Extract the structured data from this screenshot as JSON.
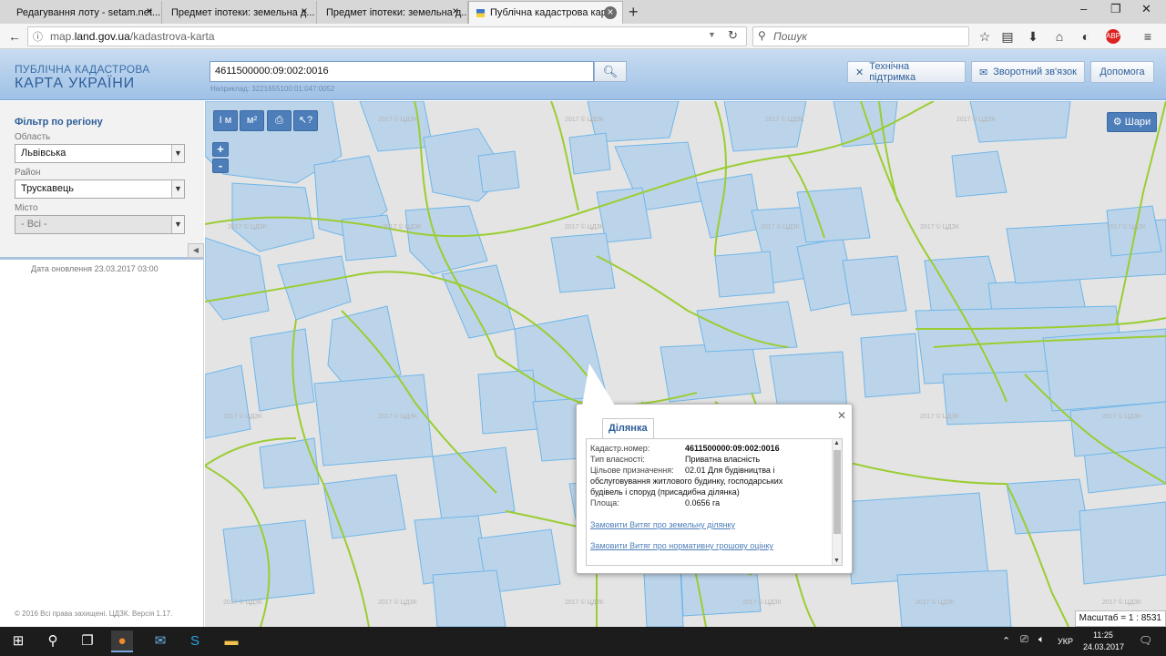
{
  "browser": {
    "tabs": [
      {
        "title": "Редагування лоту - setam.net..."
      },
      {
        "title": "Предмет іпотеки: земельна д..."
      },
      {
        "title": "Предмет іпотеки: земельна д..."
      },
      {
        "title": "Публічна кадастрова кар..."
      }
    ],
    "url_prefix": "map.",
    "url_domain": "land.gov.ua",
    "url_path": "/kadastrova-karta",
    "search_placeholder": "Пошук"
  },
  "header": {
    "logo_line1": "ПУБЛІЧНА КАДАСТРОВА",
    "logo_line2": "КАРТА УКРАЇНИ",
    "cad_input_value": "4611500000:09:002:0016",
    "example_text": "Наприклад: 3221655100:01:047:0052",
    "buttons": {
      "support": "Технічна підтримка",
      "feedback": "Зворотний зв'язок",
      "help": "Допомога"
    }
  },
  "filter": {
    "title": "Фільтр по регіону",
    "oblast_label": "Область",
    "oblast_value": "Львівська",
    "rayon_label": "Район",
    "rayon_value": "Трускавець",
    "misto_label": "Місто",
    "misto_value": "- Всі -",
    "update_label": "Дата оновлення",
    "update_value": "23.03.2017 03:00",
    "copyright": "© 2016 Всі права захищені. ЦДЗК. Версія 1.17."
  },
  "map": {
    "tools": {
      "measure_line": "I м",
      "measure_area": "м²",
      "print": "print",
      "identify": "?"
    },
    "zoom_in": "+",
    "zoom_out": "-",
    "layers_label": "Шари",
    "scale_text": "Масштаб = 1 : 8531",
    "watermark": "2017 © ЦДЗК"
  },
  "popup": {
    "tab_label": "Ділянка",
    "rows": [
      {
        "label": "Кадастр.номер:",
        "value": "4611500000:09:002:0016"
      },
      {
        "label": "Тип власності:",
        "value": "Приватна власність"
      },
      {
        "label": "Цільове призначення:",
        "value": "02.01 Для будівництва і"
      },
      {
        "label": "Площа:",
        "value": "0.0656 га"
      }
    ],
    "purpose_cont_1": "обслуговування житлового будинку, господарських",
    "purpose_cont_2": "будівель і споруд (присадибна ділянка)",
    "link1": "Замовити Витяг про земельну ділянку",
    "link2": "Замовити Витяг про нормативну грошову оцінку"
  },
  "taskbar": {
    "lang": "УКР",
    "time": "11:25",
    "date": "24.03.2017"
  },
  "colors": {
    "parcel_fill": "#bcd4ea",
    "parcel_stroke": "#6fb6e8",
    "boundary": "#9acd32",
    "header_blue": "#2d5e99"
  }
}
